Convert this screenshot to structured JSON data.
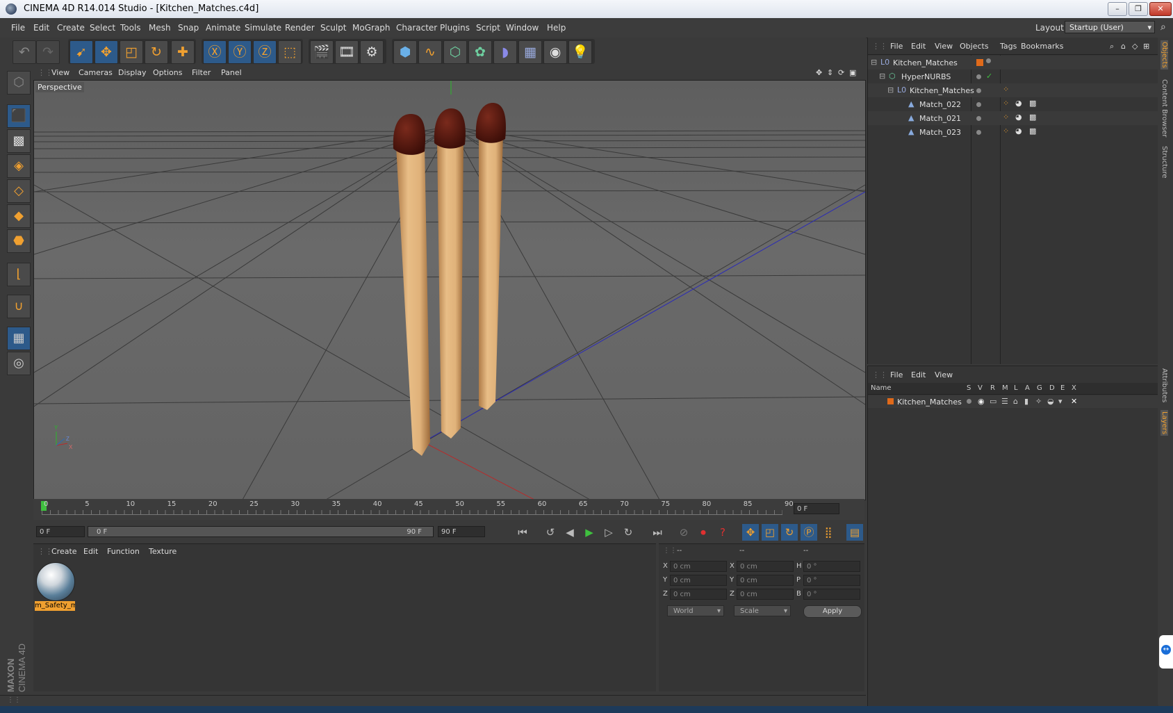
{
  "window": {
    "title": "CINEMA 4D R14.014 Studio - [Kitchen_Matches.c4d]"
  },
  "menubar": {
    "items": [
      "File",
      "Edit",
      "Create",
      "Select",
      "Tools",
      "Mesh",
      "Snap",
      "Animate",
      "Simulate",
      "Render",
      "Sculpt",
      "MoGraph",
      "Character",
      "Plugins",
      "Script",
      "Window",
      "Help"
    ],
    "layout_label": "Layout:",
    "layout_value": "Startup (User)"
  },
  "viewport": {
    "menu": [
      "View",
      "Cameras",
      "Display",
      "Options",
      "Filter",
      "Panel"
    ],
    "label": "Perspective",
    "axis_y": "Y",
    "axis_z": "Z",
    "axis_x": "X"
  },
  "timeline": {
    "ticks": [
      "0",
      "5",
      "10",
      "15",
      "20",
      "25",
      "30",
      "35",
      "40",
      "45",
      "50",
      "55",
      "60",
      "65",
      "70",
      "75",
      "80",
      "85",
      "90"
    ],
    "current_frame": "0 F",
    "start_field": "0 F",
    "range_start": "0 F",
    "range_end": "90 F",
    "end_field": "90 F"
  },
  "materials": {
    "menu": [
      "Create",
      "Edit",
      "Function",
      "Texture"
    ],
    "items": [
      {
        "label": "m_Safety_m"
      }
    ]
  },
  "coords": {
    "headers": [
      "--",
      "--",
      "--"
    ],
    "rows": [
      {
        "a": "X",
        "av": "0 cm",
        "b": "X",
        "bv": "0 cm",
        "c": "H",
        "cv": "0 °"
      },
      {
        "a": "Y",
        "av": "0 cm",
        "b": "Y",
        "bv": "0 cm",
        "c": "P",
        "cv": "0 °"
      },
      {
        "a": "Z",
        "av": "0 cm",
        "b": "Z",
        "bv": "0 cm",
        "c": "B",
        "cv": "0 °"
      }
    ],
    "space": "World",
    "mode": "Scale",
    "apply": "Apply"
  },
  "objects": {
    "menu": [
      "File",
      "Edit",
      "View",
      "Objects",
      "Tags",
      "Bookmarks"
    ],
    "tree": [
      {
        "name": "Kitchen_Matches",
        "level": 0
      },
      {
        "name": "HyperNURBS",
        "level": 1
      },
      {
        "name": "Kitchen_Matches",
        "level": 2
      },
      {
        "name": "Match_022",
        "level": 3
      },
      {
        "name": "Match_021",
        "level": 3
      },
      {
        "name": "Match_023",
        "level": 3
      }
    ]
  },
  "layers": {
    "menu": [
      "File",
      "Edit",
      "View"
    ],
    "columns": [
      "Name",
      "S",
      "V",
      "R",
      "M",
      "L",
      "A",
      "G",
      "D",
      "E",
      "X"
    ],
    "rows": [
      {
        "name": "Kitchen_Matches"
      }
    ]
  },
  "right_tabs": [
    "Objects",
    "Content Browser",
    "Structure",
    "Attributes",
    "Layers"
  ],
  "brand": {
    "line1": "MAXON",
    "line2": "CINEMA 4D"
  },
  "colors": {
    "accent": "#f0a030",
    "layer_color": "#e06a1a",
    "match_head": "#5a1a10",
    "match_stick": "#e0b27a"
  }
}
